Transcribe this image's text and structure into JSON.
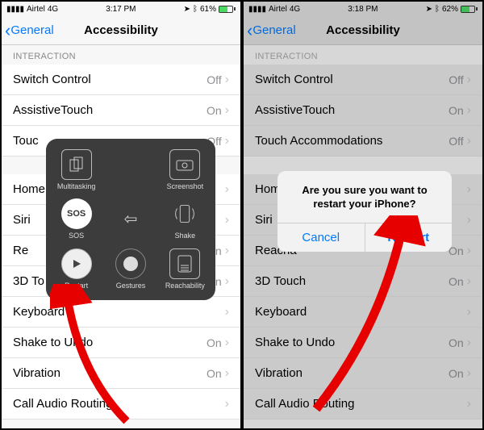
{
  "left": {
    "status": {
      "carrier": "Airtel",
      "network": "4G",
      "time": "3:17 PM",
      "battery": "61%"
    },
    "header": {
      "back": "General",
      "title": "Accessibility"
    },
    "section": "INTERACTION",
    "rows1": [
      {
        "label": "Switch Control",
        "value": "Off"
      },
      {
        "label": "AssistiveTouch",
        "value": "On"
      },
      {
        "label": "Touc",
        "value": "Off"
      }
    ],
    "rows2": [
      {
        "label": "Home",
        "value": ""
      },
      {
        "label": "Siri",
        "value": ""
      },
      {
        "label": "Re",
        "value": "On"
      },
      {
        "label": "3D To",
        "value": "On"
      },
      {
        "label": "Keyboard",
        "value": ""
      },
      {
        "label": "Shake to Undo",
        "value": "On"
      },
      {
        "label": "Vibration",
        "value": "On"
      },
      {
        "label": "Call Audio Routing",
        "value": ""
      }
    ],
    "panel": {
      "multitasking": "Multitasking",
      "screenshot": "Screenshot",
      "sos": "SOS",
      "shake": "Shake",
      "restart": "Restart",
      "gestures": "Gestures",
      "reachability": "Reachability"
    }
  },
  "right": {
    "status": {
      "carrier": "Airtel",
      "network": "4G",
      "time": "3:18 PM",
      "battery": "62%"
    },
    "header": {
      "back": "General",
      "title": "Accessibility"
    },
    "section": "INTERACTION",
    "rows1": [
      {
        "label": "Switch Control",
        "value": "Off"
      },
      {
        "label": "AssistiveTouch",
        "value": "On"
      },
      {
        "label": "Touch Accommodations",
        "value": "Off"
      }
    ],
    "rows2": [
      {
        "label": "Home P",
        "value": ""
      },
      {
        "label": "Siri",
        "value": ""
      },
      {
        "label": "Reacha",
        "value": "On"
      },
      {
        "label": "3D Touch",
        "value": "On"
      },
      {
        "label": "Keyboard",
        "value": ""
      },
      {
        "label": "Shake to Undo",
        "value": "On"
      },
      {
        "label": "Vibration",
        "value": "On"
      },
      {
        "label": "Call Audio Routing",
        "value": ""
      }
    ],
    "alert": {
      "message": "Are you sure you want to restart your iPhone?",
      "cancel": "Cancel",
      "restart": "Restart"
    }
  }
}
